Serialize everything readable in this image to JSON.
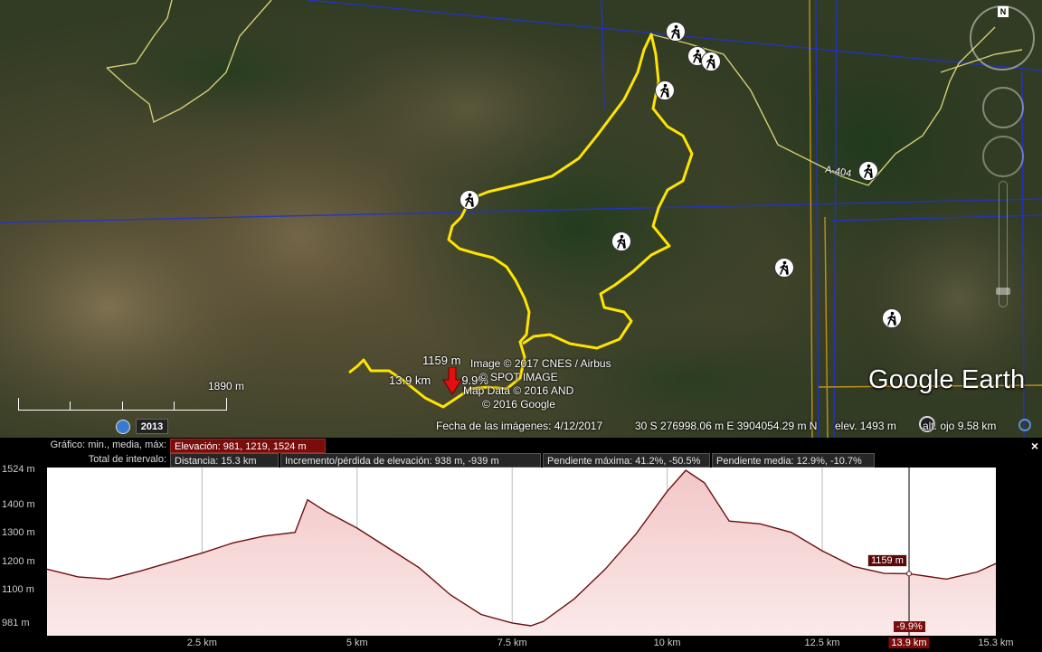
{
  "map": {
    "compass_label": "N",
    "road_label": "A-404",
    "marker": {
      "elevation": "1159 m",
      "distance": "13.9 km",
      "grade": "-9.9%"
    },
    "attribution": [
      "Image © 2017 CNES / Airbus",
      "© SPOT IMAGE",
      "Map Data © 2016 AND",
      "© 2016 Google"
    ],
    "scale_label": "1890 m",
    "history_year": "2013",
    "logo": "Google Earth"
  },
  "status": {
    "imagery_date": "Fecha de las imágenes: 4/12/2017",
    "coords": "30 S 276998.06 m E 3904054.29 m N",
    "elev": "elev.  1493 m",
    "eye_alt": "alt. ojo   9.58 km"
  },
  "panel": {
    "graph_label": "Gráfico: min., media, máx:",
    "elevation_tab": "Elevación: 981, 1219, 1524 m",
    "range_label": "Total de intervalo:",
    "distance": "Distancia: 15.3 km",
    "gain_loss": "Incremento/pérdida de elevación: 938 m, -939 m",
    "max_slope": "Pendiente máxima: 41.2%, -50.5%",
    "avg_slope": "Pendiente media: 12.9%, -10.7%",
    "close_label": "×",
    "tooltip_elevation": "1159 m",
    "tooltip_grade": "-9.9%",
    "colors": {
      "fill": "#f2c7c7",
      "line": "#6b0f0f",
      "highlight": "#7a0c0c"
    }
  },
  "chart_data": {
    "type": "area",
    "title": "",
    "xlabel": "",
    "ylabel": "",
    "x": [
      0,
      0.5,
      1,
      1.5,
      2,
      2.5,
      3,
      3.5,
      4,
      4.2,
      4.5,
      5,
      5.5,
      6,
      6.5,
      7,
      7.5,
      7.8,
      8,
      8.5,
      9,
      9.5,
      10,
      10.3,
      10.6,
      11,
      11.5,
      12,
      12.5,
      13,
      13.5,
      13.9,
      14.5,
      15,
      15.3
    ],
    "y": [
      1175,
      1148,
      1140,
      1168,
      1200,
      1232,
      1268,
      1292,
      1305,
      1420,
      1378,
      1320,
      1250,
      1180,
      1085,
      1015,
      985,
      975,
      990,
      1070,
      1175,
      1300,
      1450,
      1524,
      1480,
      1345,
      1335,
      1305,
      1240,
      1185,
      1160,
      1159,
      1140,
      1165,
      1195
    ],
    "xlim": [
      0,
      15.3
    ],
    "ylim": [
      940,
      1534
    ],
    "ytick_values": [
      981,
      1100,
      1200,
      1300,
      1400,
      1524
    ],
    "ytick_labels": [
      "981 m",
      "1100 m",
      "1200 m",
      "1300 m",
      "1400 m",
      "1524 m"
    ],
    "xtick_values": [
      2.5,
      5,
      7.5,
      10,
      12.5,
      13.9,
      15.3
    ],
    "xtick_labels": [
      "2.5 km",
      "5 km",
      "7.5 km",
      "10 km",
      "12.5 km",
      "13.9 km",
      "15.3 km"
    ],
    "cursor_x": 13.9,
    "grid": true
  }
}
